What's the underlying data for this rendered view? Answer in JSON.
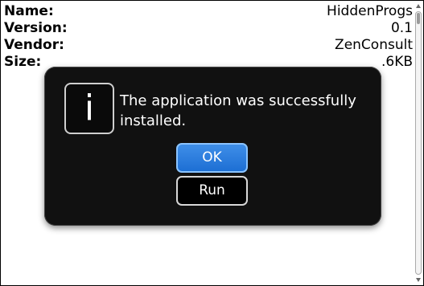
{
  "details": [
    {
      "label": "Name:",
      "value": "HiddenProgs"
    },
    {
      "label": "Version:",
      "value": "0.1"
    },
    {
      "label": "Vendor:",
      "value": "ZenConsult"
    },
    {
      "label": "Size:",
      "value": ".6KB"
    }
  ],
  "dialog": {
    "icon_glyph": "i",
    "message": "The application was successfully installed.",
    "ok_label": "OK",
    "run_label": "Run"
  }
}
